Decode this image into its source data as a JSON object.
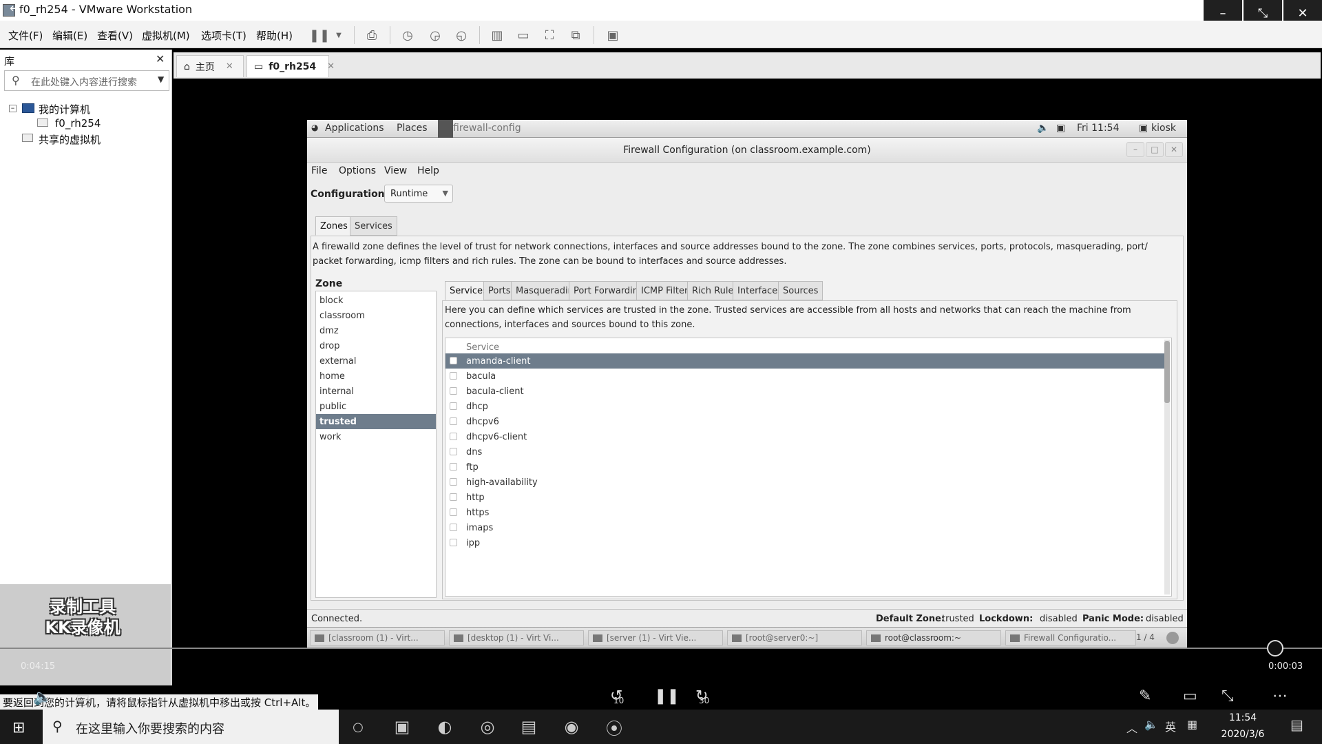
{
  "vmware": {
    "window_title": "f0_rh254 - VMware Workstation",
    "menus": [
      "文件(F)",
      "编辑(E)",
      "查看(V)",
      "虚拟机(M)",
      "选项卡(T)",
      "帮助(H)"
    ],
    "library": {
      "title": "库",
      "search_placeholder": "在此处键入内容进行搜索",
      "tree": {
        "my_computer": "我的计算机",
        "vm": "f0_rh254",
        "shared": "共享的虚拟机"
      }
    },
    "tabs": [
      {
        "label": "主页"
      },
      {
        "label": "f0_rh254"
      }
    ],
    "status_hint": "要返回到您的计算机，请将鼠标指针从虚拟机中移出或按 Ctrl+Alt。"
  },
  "gnome_topbar": {
    "applications": "Applications",
    "places": "Places",
    "active_app": "firewall-config",
    "clock": "Fri 11:54",
    "user": "kiosk"
  },
  "firewall": {
    "title": "Firewall Configuration (on classroom.example.com)",
    "menu": [
      "File",
      "Options",
      "View",
      "Help"
    ],
    "configuration_label": "Configuration:",
    "configuration_value": "Runtime",
    "main_tabs": [
      "Zones",
      "Services"
    ],
    "zone_description": "A firewalld zone defines the level of trust for network connections, interfaces and source addresses bound to the zone. The zone combines services, ports, protocols, masquerading, port/ packet forwarding, icmp filters and rich rules. The zone can be bound to interfaces and source addresses.",
    "zone_header": "Zone",
    "zones": [
      "block",
      "classroom",
      "dmz",
      "drop",
      "external",
      "home",
      "internal",
      "public",
      "trusted",
      "work"
    ],
    "selected_zone": "trusted",
    "sub_tabs": [
      "Services",
      "Ports",
      "Masquerading",
      "Port Forwarding",
      "ICMP Filter",
      "Rich Rules",
      "Interfaces",
      "Sources"
    ],
    "services_description": "Here you can define which services are trusted in the zone. Trusted services are accessible from all hosts and networks that can reach the machine from connections, interfaces and sources bound to this zone.",
    "service_column": "Service",
    "services": [
      "amanda-client",
      "bacula",
      "bacula-client",
      "dhcp",
      "dhcpv6",
      "dhcpv6-client",
      "dns",
      "ftp",
      "high-availability",
      "http",
      "https",
      "imaps",
      "ipp"
    ],
    "selected_service": "amanda-client",
    "status": {
      "connected": "Connected.",
      "default_zone_label": "Default Zone:",
      "default_zone": "trusted",
      "lockdown_label": "Lockdown:",
      "lockdown": "disabled",
      "panic_label": "Panic Mode:",
      "panic": "disabled"
    }
  },
  "gnome_taskbar": {
    "items": [
      "[classroom (1) - Virt...",
      "[desktop (1) - Virt Vi...",
      "[server (1) - Virt Vie...",
      "[root@server0:~]",
      "root@classroom:~",
      "Firewall Configuratio..."
    ],
    "workspace": "1 / 4"
  },
  "player": {
    "elapsed": "0:04:15",
    "remaining": "0:00:03",
    "rewind_label": "10",
    "forward_label": "30",
    "watermark_line1": "录制工具",
    "watermark_line2": "KK录像机"
  },
  "windows": {
    "search_placeholder": "在这里输入你要搜索的内容",
    "tray_lang": "英",
    "time": "11:54",
    "date": "2020/3/6"
  }
}
